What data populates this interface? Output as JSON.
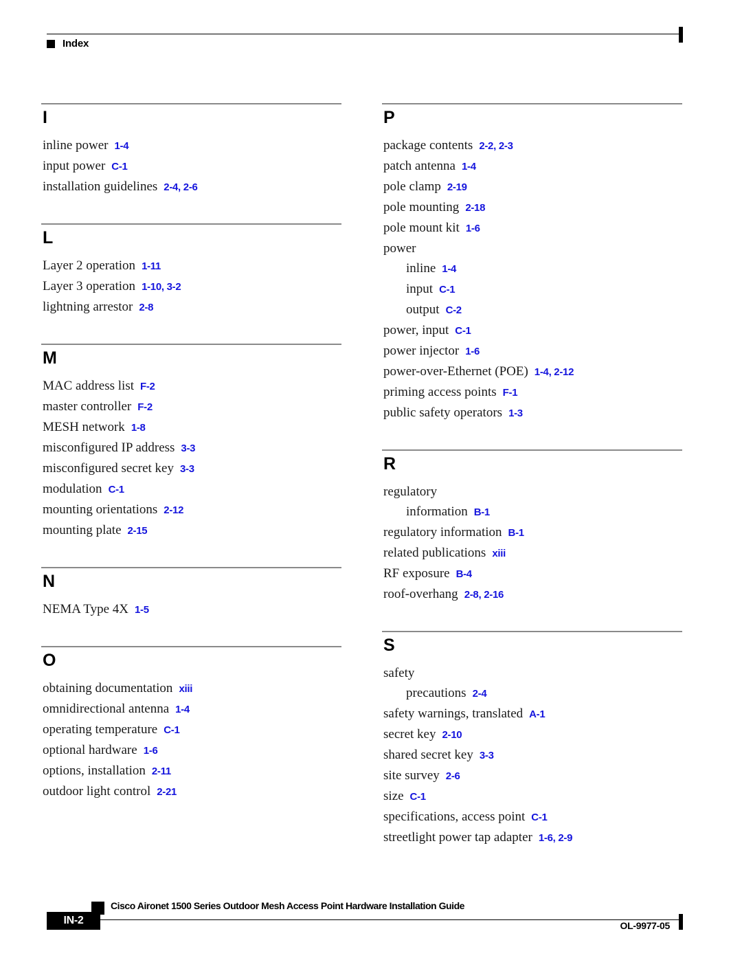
{
  "header": {
    "label": "Index",
    "bullet_icon": "black-square-icon"
  },
  "colors": {
    "page_reference": "#1515dd",
    "section_rule": "#8a8a8a",
    "text": "#1a1a1a",
    "footer_box": "#000000"
  },
  "columns": [
    {
      "name": "left",
      "sections": [
        {
          "letter": "I",
          "entries": [
            {
              "term": "inline power",
              "pages": "1-4",
              "level": 0
            },
            {
              "term": "input power",
              "pages": "C-1",
              "level": 0
            },
            {
              "term": "installation guidelines",
              "pages": "2-4, 2-6",
              "level": 0
            }
          ]
        },
        {
          "letter": "L",
          "entries": [
            {
              "term": "Layer 2 operation",
              "pages": "1-11",
              "level": 0
            },
            {
              "term": "Layer 3 operation",
              "pages": "1-10, 3-2",
              "level": 0
            },
            {
              "term": "lightning arrestor",
              "pages": "2-8",
              "level": 0
            }
          ]
        },
        {
          "letter": "M",
          "entries": [
            {
              "term": "MAC address list",
              "pages": "F-2",
              "level": 0
            },
            {
              "term": "master controller",
              "pages": "F-2",
              "level": 0
            },
            {
              "term": "MESH network",
              "pages": "1-8",
              "level": 0
            },
            {
              "term": "misconfigured IP address",
              "pages": "3-3",
              "level": 0
            },
            {
              "term": "misconfigured secret key",
              "pages": "3-3",
              "level": 0
            },
            {
              "term": "modulation",
              "pages": "C-1",
              "level": 0
            },
            {
              "term": "mounting orientations",
              "pages": "2-12",
              "level": 0
            },
            {
              "term": "mounting plate",
              "pages": "2-15",
              "level": 0
            }
          ]
        },
        {
          "letter": "N",
          "entries": [
            {
              "term": "NEMA Type 4X",
              "pages": "1-5",
              "level": 0
            }
          ]
        },
        {
          "letter": "O",
          "entries": [
            {
              "term": "obtaining documentation",
              "pages": "xiii",
              "level": 0
            },
            {
              "term": "omnidirectional antenna",
              "pages": "1-4",
              "level": 0
            },
            {
              "term": "operating temperature",
              "pages": "C-1",
              "level": 0
            },
            {
              "term": "optional hardware",
              "pages": "1-6",
              "level": 0
            },
            {
              "term": "options, installation",
              "pages": "2-11",
              "level": 0
            },
            {
              "term": "outdoor light control",
              "pages": "2-21",
              "level": 0
            }
          ]
        }
      ]
    },
    {
      "name": "right",
      "sections": [
        {
          "letter": "P",
          "entries": [
            {
              "term": "package contents",
              "pages": "2-2, 2-3",
              "level": 0
            },
            {
              "term": "patch antenna",
              "pages": "1-4",
              "level": 0
            },
            {
              "term": "pole clamp",
              "pages": "2-19",
              "level": 0
            },
            {
              "term": "pole mounting",
              "pages": "2-18",
              "level": 0
            },
            {
              "term": "pole mount kit",
              "pages": "1-6",
              "level": 0
            },
            {
              "term": "power",
              "pages": "",
              "level": 0
            },
            {
              "term": "inline",
              "pages": "1-4",
              "level": 1
            },
            {
              "term": "input",
              "pages": "C-1",
              "level": 1
            },
            {
              "term": "output",
              "pages": "C-2",
              "level": 1
            },
            {
              "term": "power, input",
              "pages": "C-1",
              "level": 0
            },
            {
              "term": "power injector",
              "pages": "1-6",
              "level": 0
            },
            {
              "term": "power-over-Ethernet (POE)",
              "pages": "1-4, 2-12",
              "level": 0
            },
            {
              "term": "priming access points",
              "pages": "F-1",
              "level": 0
            },
            {
              "term": "public safety operators",
              "pages": "1-3",
              "level": 0
            }
          ]
        },
        {
          "letter": "R",
          "entries": [
            {
              "term": "regulatory",
              "pages": "",
              "level": 0
            },
            {
              "term": "information",
              "pages": "B-1",
              "level": 1
            },
            {
              "term": "regulatory information",
              "pages": "B-1",
              "level": 0
            },
            {
              "term": "related publications",
              "pages": "xiii",
              "level": 0
            },
            {
              "term": "RF exposure",
              "pages": "B-4",
              "level": 0
            },
            {
              "term": "roof-overhang",
              "pages": "2-8, 2-16",
              "level": 0
            }
          ]
        },
        {
          "letter": "S",
          "entries": [
            {
              "term": "safety",
              "pages": "",
              "level": 0
            },
            {
              "term": "precautions",
              "pages": "2-4",
              "level": 1
            },
            {
              "term": "safety warnings, translated",
              "pages": "A-1",
              "level": 0
            },
            {
              "term": "secret key",
              "pages": "2-10",
              "level": 0
            },
            {
              "term": "shared secret key",
              "pages": "3-3",
              "level": 0
            },
            {
              "term": "site survey",
              "pages": "2-6",
              "level": 0
            },
            {
              "term": "size",
              "pages": "C-1",
              "level": 0
            },
            {
              "term": "specifications, access point",
              "pages": "C-1",
              "level": 0
            },
            {
              "term": "streetlight power tap adapter",
              "pages": "1-6, 2-9",
              "level": 0
            }
          ]
        }
      ]
    }
  ],
  "footer": {
    "page_number": "IN-2",
    "document_title": "Cisco Aironet 1500 Series Outdoor Mesh Access Point Hardware Installation Guide",
    "doc_id": "OL-9977-05"
  }
}
